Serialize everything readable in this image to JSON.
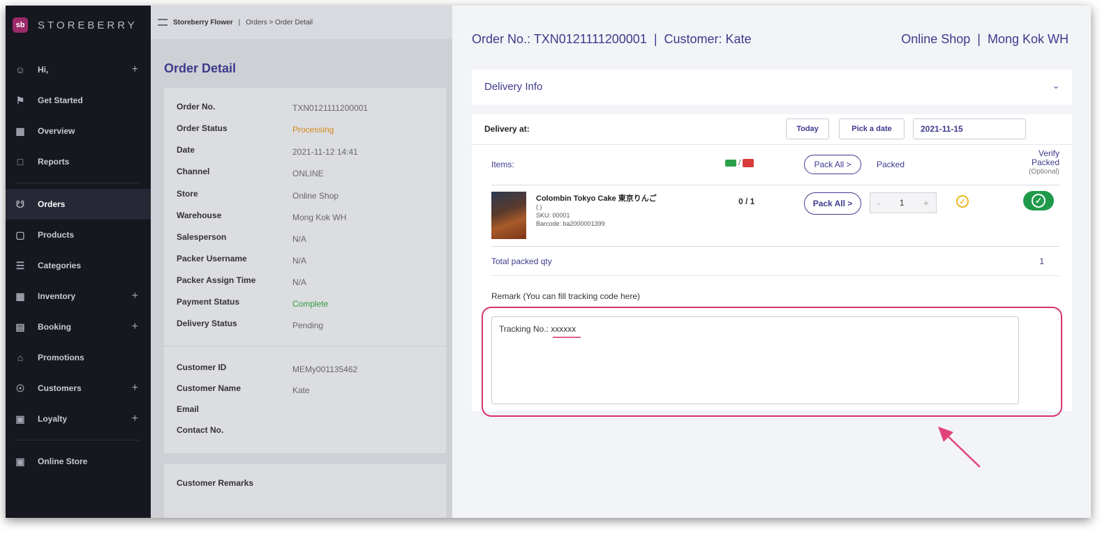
{
  "brand": {
    "name": "STOREBERRY",
    "logo": "sb"
  },
  "sidebar": {
    "items": [
      {
        "label": "Hi,",
        "icon": "user-icon",
        "plus": "+"
      },
      {
        "label": "Get Started",
        "icon": "flag-icon"
      },
      {
        "label": "Overview",
        "icon": "chart-icon"
      },
      {
        "label": "Reports",
        "icon": "document-icon"
      },
      {
        "label": "Orders",
        "icon": "cart-icon"
      },
      {
        "label": "Products",
        "icon": "bag-icon"
      },
      {
        "label": "Categories",
        "icon": "list-icon"
      },
      {
        "label": "Inventory",
        "icon": "boxes-icon",
        "plus": "+"
      },
      {
        "label": "Booking",
        "icon": "calendar-icon",
        "plus": "+"
      },
      {
        "label": "Promotions",
        "icon": "home-icon"
      },
      {
        "label": "Customers",
        "icon": "person-circle-icon",
        "plus": "+"
      },
      {
        "label": "Loyalty",
        "icon": "ticket-icon",
        "plus": "+"
      },
      {
        "label": "Online Store",
        "icon": "store-icon"
      }
    ]
  },
  "topbar": {
    "store": "Storeberry Flower",
    "sep": "|",
    "crumbs": "Orders > Order Detail"
  },
  "order_detail": {
    "title": "Order Detail",
    "fields": [
      {
        "label": "Order No.",
        "value": "TXN0121111200001"
      },
      {
        "label": "Order Status",
        "value": "Processing"
      },
      {
        "label": "Date",
        "value": "2021-11-12 14:41"
      },
      {
        "label": "Channel",
        "value": "ONLINE"
      },
      {
        "label": "Store",
        "value": "Online Shop"
      },
      {
        "label": "Warehouse",
        "value": "Mong Kok WH"
      },
      {
        "label": "Salesperson",
        "value": "N/A"
      },
      {
        "label": "Packer Username",
        "value": "N/A"
      },
      {
        "label": "Packer Assign Time",
        "value": "N/A"
      },
      {
        "label": "Payment Status",
        "value": "Complete"
      },
      {
        "label": "Delivery Status",
        "value": "Pending"
      }
    ],
    "customer_fields": [
      {
        "label": "Customer ID",
        "value": "MEMy001135462"
      },
      {
        "label": "Customer Name",
        "value": "Kate"
      },
      {
        "label": "Email",
        "value": ""
      },
      {
        "label": "Contact No.",
        "value": ""
      }
    ],
    "remarks_title": "Customer Remarks"
  },
  "panel": {
    "header_left": "Order No.: TXN0121111200001  |  Customer: Kate",
    "header_right": "Online Shop  |  Mong Kok WH",
    "delivery_info": "Delivery Info",
    "delivery_at_label": "Delivery at:",
    "today_btn": "Today",
    "pick_date_btn": "Pick a date",
    "date_value": "2021-11-15",
    "items_label": "Items:",
    "truck_sep": "/",
    "pack_all_label": "Pack All >",
    "packed_label": "Packed",
    "verify_label_1": "Verify",
    "verify_label_2": "Packed",
    "verify_optional": "(Optional)",
    "item": {
      "name": "Colombin Tokyo Cake 東京りんご",
      "variant": "( )",
      "sku": "SKU: 00001",
      "barcode": "Barcode: ba2000001399",
      "ratio": "0 / 1",
      "qty": "1",
      "minus": "-",
      "plus": "+"
    },
    "total_label": "Total packed qty",
    "total_value": "1",
    "remark_label": "Remark (You can fill tracking code here)",
    "remark_value": "Tracking No.: xxxxxx"
  }
}
